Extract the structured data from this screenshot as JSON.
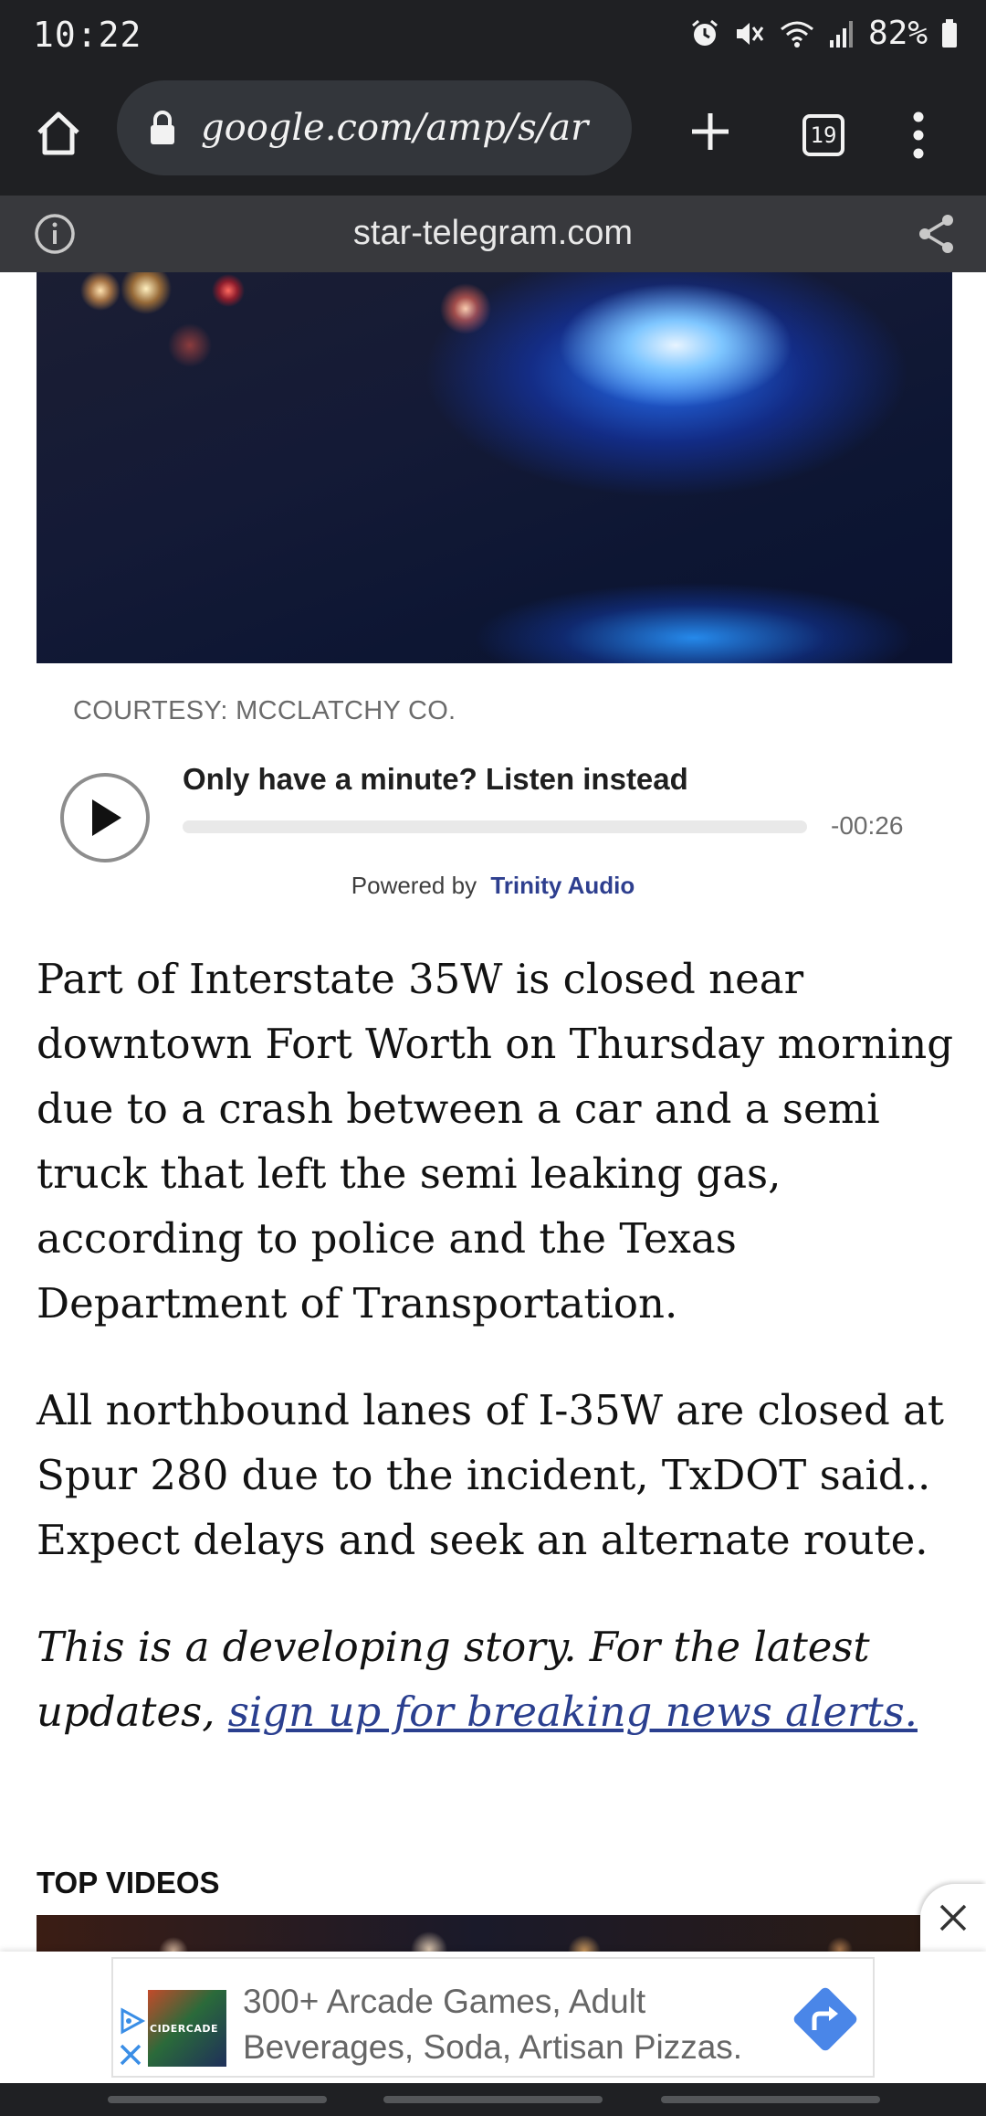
{
  "status_bar": {
    "time": "10:22",
    "battery_percent": "82%",
    "icons": [
      "alarm-icon",
      "mute-icon",
      "wifi-icon",
      "signal-icon",
      "battery-icon"
    ]
  },
  "browser": {
    "url": "google.com/amp/s/ar",
    "tab_count": "19",
    "icons": [
      "home-icon",
      "lock-icon",
      "plus-icon",
      "tabs-icon",
      "more-vert-icon"
    ]
  },
  "amp_header": {
    "domain": "star-telegram.com",
    "icons": [
      "info-icon",
      "share-icon"
    ]
  },
  "hero": {
    "credit": "COURTESY: MCCLATCHY CO."
  },
  "audio_player": {
    "title": "Only have a minute? Listen instead",
    "time_remaining": "-00:26",
    "progress": 0,
    "powered_by_label": "Powered by",
    "powered_by_brand": "Trinity Audio"
  },
  "article": {
    "paragraph_1": "Part of Interstate 35W is closed near downtown Fort Worth on Thursday morning due to a crash between a car and a semi truck that left the semi leaking gas, according to police and the Texas Department of Transportation.",
    "paragraph_2": "All northbound lanes of I-35W are closed at Spur 280 due to the incident, TxDOT said.. Expect delays and seek an alternate route.",
    "developing_prefix": "This is a developing story. For the latest updates, ",
    "alerts_link": "sign up for breaking news alerts."
  },
  "top_videos": {
    "heading": "TOP VIDEOS"
  },
  "ad": {
    "text": "300+ Arcade Games, Adult Beverages, Soda, Artisan Pizzas.",
    "logo_text": "CIDERCADE",
    "accent_color": "#4a86e8"
  },
  "colors": {
    "chrome_dark": "#1f2023",
    "amp_bar": "#38393d",
    "link": "#2a3f8f"
  }
}
